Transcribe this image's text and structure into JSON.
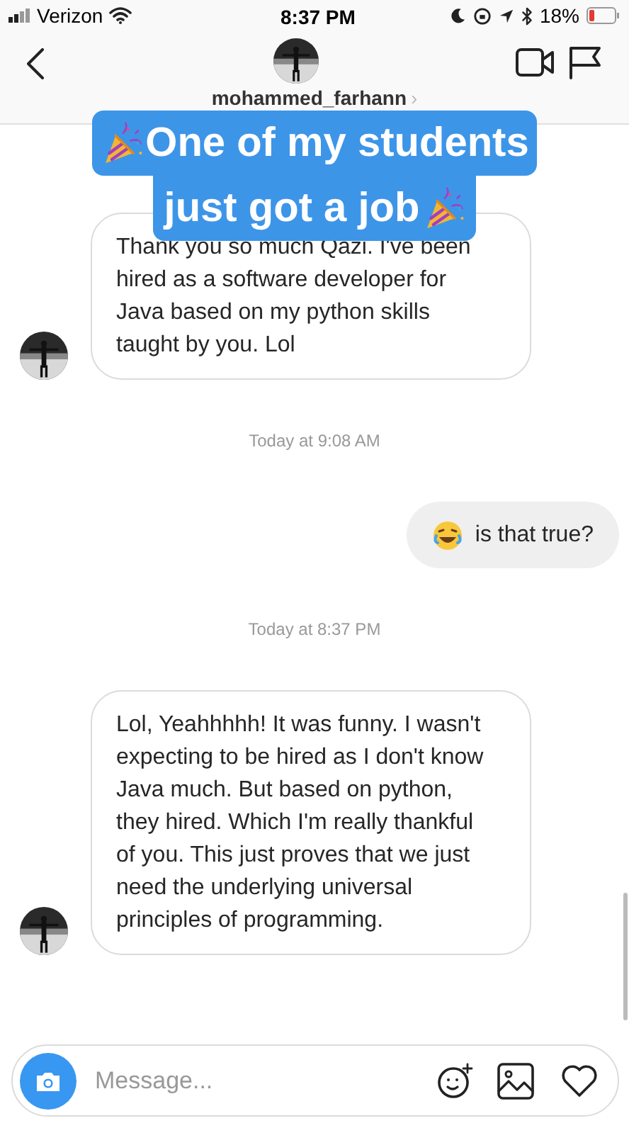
{
  "status_bar": {
    "carrier": "Verizon",
    "time": "8:37 PM",
    "battery": "18%"
  },
  "header": {
    "username": "mohammed_farhann",
    "chevron": "›"
  },
  "banner": {
    "lines": [
      "One of my students",
      "just got a job"
    ]
  },
  "messages": [
    {
      "kind": "received",
      "text": "Thank you so much Qazi. I've been hired as a software developer for Java based on my python skills taught by you. Lol"
    },
    {
      "kind": "timestamp",
      "text": "Today at 9:08 AM"
    },
    {
      "kind": "sent",
      "text": "is that true?"
    },
    {
      "kind": "timestamp",
      "text": "Today at 8:37 PM"
    },
    {
      "kind": "received",
      "text": "Lol, Yeahhhhh! It was funny. I wasn't expecting to be hired as I don't know Java much. But based on python, they hired. Which I'm really thankful of you. This just proves that we just need the  underlying universal principles of programming."
    }
  ],
  "composer": {
    "placeholder": "Message..."
  }
}
